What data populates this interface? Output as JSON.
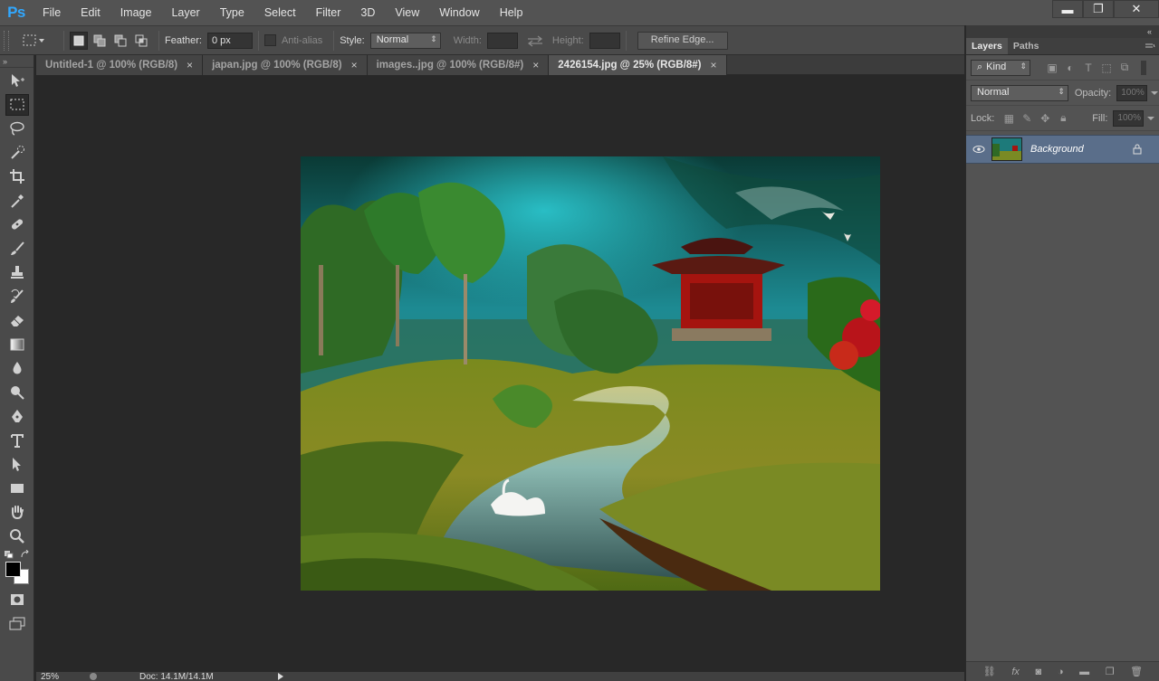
{
  "app": {
    "logo": "Ps"
  },
  "menu": [
    "File",
    "Edit",
    "Image",
    "Layer",
    "Type",
    "Select",
    "Filter",
    "3D",
    "View",
    "Window",
    "Help"
  ],
  "window_controls": {
    "minimize": "▬",
    "restore": "❐",
    "close": "✕"
  },
  "options": {
    "feather_label": "Feather:",
    "feather_value": "0 px",
    "antialias_label": "Anti-alias",
    "style_label": "Style:",
    "style_value": "Normal",
    "width_label": "Width:",
    "height_label": "Height:",
    "refine_edge_label": "Refine Edge..."
  },
  "tabs": [
    {
      "label": "Untitled-1 @ 100% (RGB/8)",
      "close": "×"
    },
    {
      "label": "japan.jpg @ 100% (RGB/8)",
      "close": "×"
    },
    {
      "label": "images..jpg @ 100% (RGB/8#)",
      "close": "×"
    },
    {
      "label": "2426154.jpg @ 25% (RGB/8#)",
      "close": "×"
    }
  ],
  "active_tab": 3,
  "toolbox_grip": "»",
  "panel_grip": "«",
  "layers_panel": {
    "tabs": [
      "Layers",
      "Paths"
    ],
    "filter_kind": "Kind",
    "blend_mode": "Normal",
    "opacity_label": "Opacity:",
    "opacity_value": "100%",
    "lock_label": "Lock:",
    "fill_label": "Fill:",
    "fill_value": "100%",
    "layers": [
      {
        "name": "Background",
        "visible": true,
        "locked": true
      }
    ]
  },
  "status": {
    "zoom": "25%",
    "doc": "Doc: 14.1M/14.1M"
  },
  "colors": {
    "accent": "#31a8ff",
    "foreground": "#000000",
    "background": "#ffffff",
    "layer_selected": "#5a6e8a"
  }
}
